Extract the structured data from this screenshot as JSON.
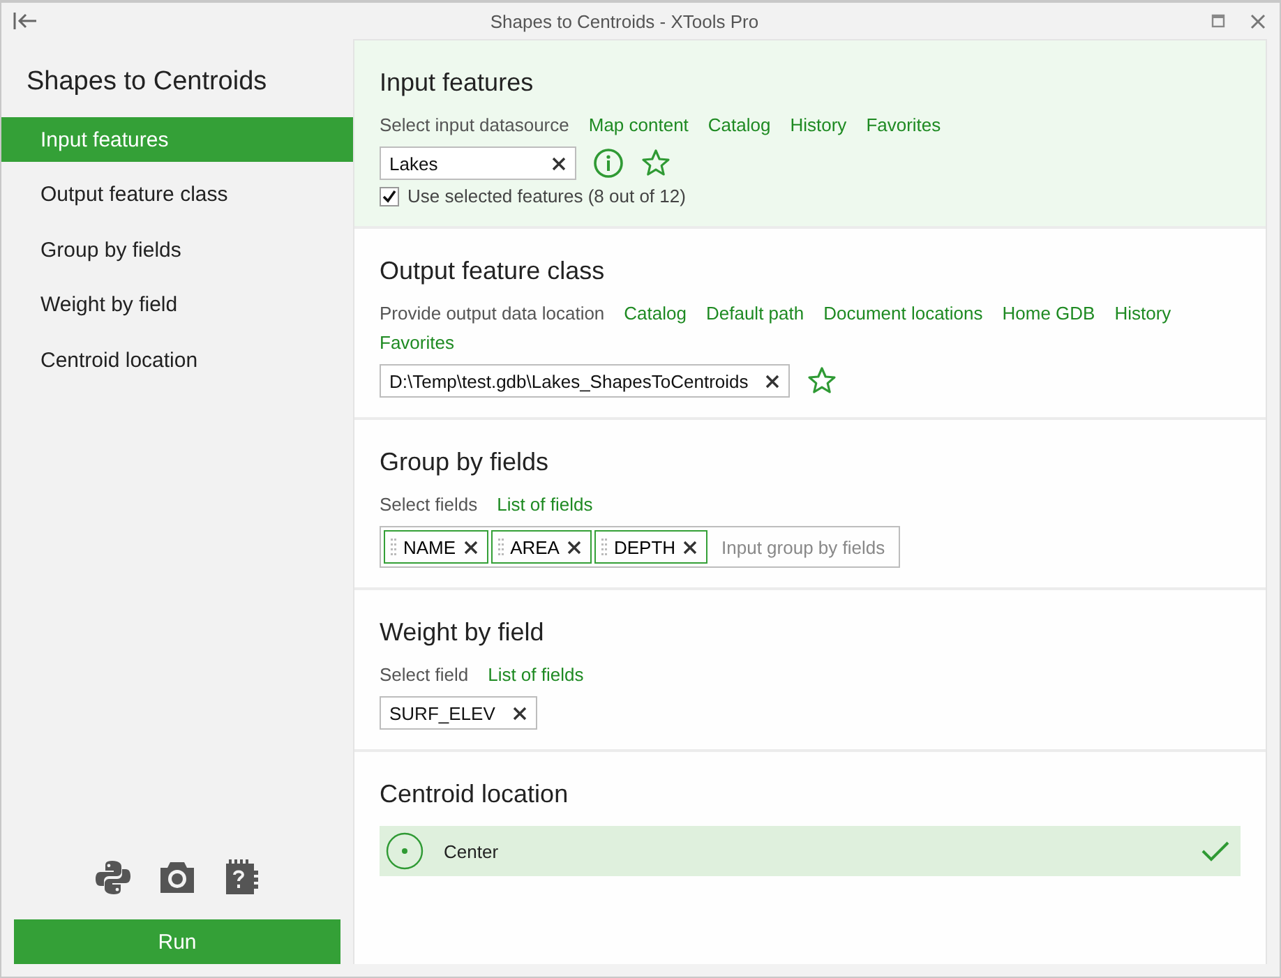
{
  "window": {
    "title": "Shapes to Centroids - XTools Pro"
  },
  "sidebar": {
    "title": "Shapes to Centroids",
    "items": [
      {
        "label": "Input features",
        "selected": true
      },
      {
        "label": "Output feature class",
        "selected": false
      },
      {
        "label": "Group by fields",
        "selected": false
      },
      {
        "label": "Weight by field",
        "selected": false
      },
      {
        "label": "Centroid location",
        "selected": false
      }
    ],
    "run_button": "Run"
  },
  "sections": [
    {
      "kind": "input",
      "title": "Input features",
      "selected": true,
      "prompt": "Select input datasource",
      "links": [
        "Map content",
        "Catalog",
        "History",
        "Favorites"
      ],
      "value": "Lakes",
      "checkbox": {
        "label": "Use selected features (8 out of 12)",
        "checked": true
      }
    },
    {
      "kind": "output",
      "title": "Output feature class",
      "selected": false,
      "prompt": "Provide output data location",
      "links": [
        "Catalog",
        "Default path",
        "Document locations",
        "Home GDB",
        "History",
        "Favorites"
      ],
      "value": "D:\\Temp\\test.gdb\\Lakes_ShapesToCentroids"
    },
    {
      "kind": "fields",
      "title": "Group by fields",
      "selected": false,
      "prompt": "Select fields",
      "links": [
        "List of fields"
      ],
      "chips": [
        "NAME",
        "AREA",
        "DEPTH"
      ],
      "placeholder": "Input group by fields"
    },
    {
      "kind": "field",
      "title": "Weight by field",
      "selected": false,
      "prompt": "Select field",
      "links": [
        "List of fields"
      ],
      "value": "SURF_ELEV"
    },
    {
      "kind": "options",
      "title": "Centroid location",
      "selected": false,
      "options": [
        {
          "label": "Center",
          "selected": true
        }
      ]
    }
  ]
}
